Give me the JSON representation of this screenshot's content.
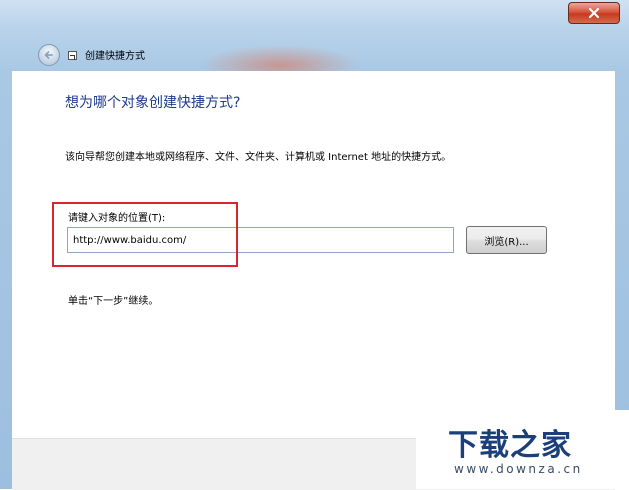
{
  "window": {
    "title": "创建快捷方式",
    "close_icon": "close-icon",
    "back_icon": "back-arrow-icon",
    "app_icon": "shortcut-icon"
  },
  "wizard": {
    "heading": "想为哪个对象创建快捷方式?",
    "description": "该向导帮您创建本地或网络程序、文件、文件夹、计算机或 Internet 地址的快捷方式。",
    "location_label": "请键入对象的位置(T):",
    "location_value": "http://www.baidu.com/",
    "browse_label": "浏览(R)...",
    "continue_hint": "单击“下一步”继续。"
  },
  "watermark": {
    "title": "下载之家",
    "url": "www.downza.cn"
  },
  "colors": {
    "heading": "#1e3a8a",
    "highlight_border": "#d9262e",
    "close_button": "#c63a1f",
    "watermark": "#1a3f7a"
  }
}
